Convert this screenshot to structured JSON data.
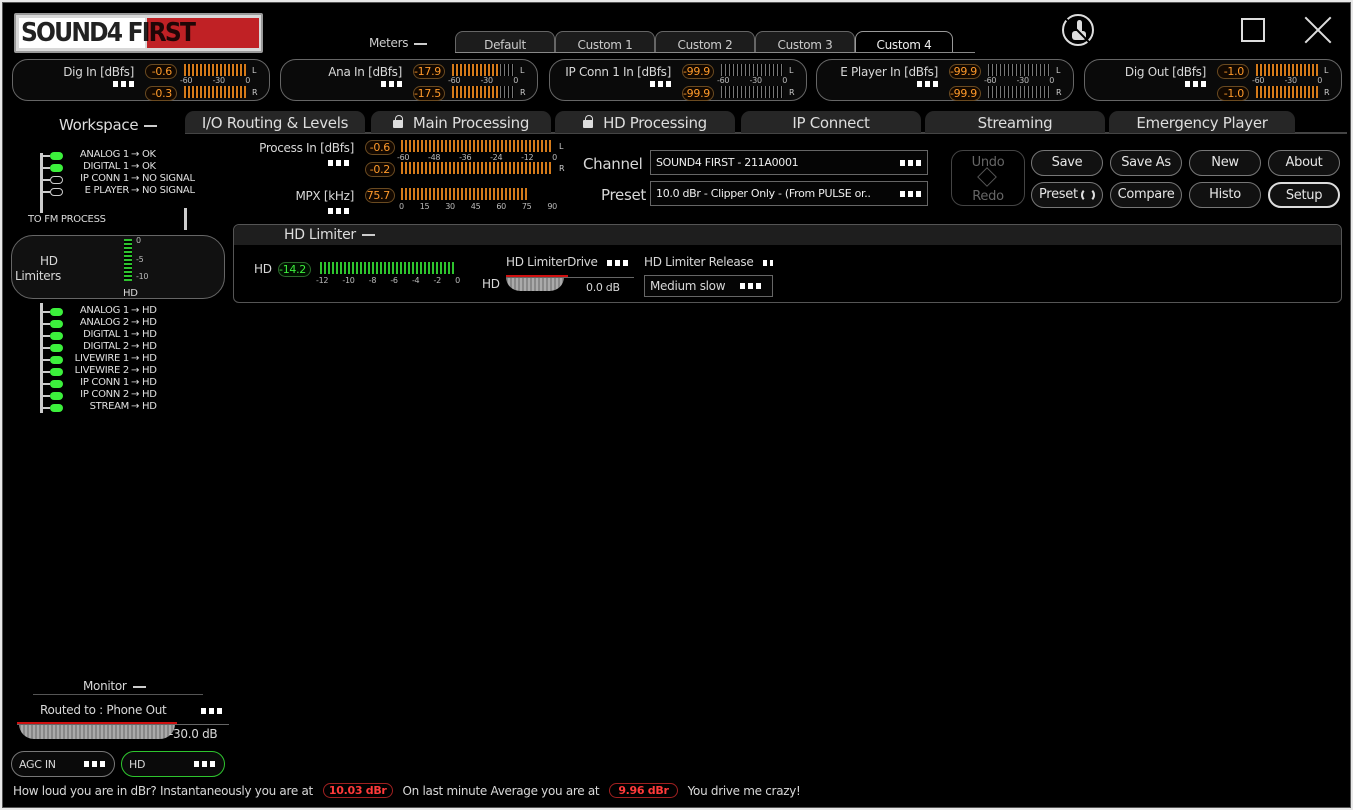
{
  "logo": {
    "text": "SOUND4 FIRST"
  },
  "window_controls": {
    "touch_icon": "touch-disabled-icon",
    "maximize_icon": "maximize-icon",
    "close_icon": "close-icon"
  },
  "meters_label": "Meters",
  "meter_tabs": [
    {
      "label": "Default",
      "active": false
    },
    {
      "label": "Custom 1",
      "active": false
    },
    {
      "label": "Custom 2",
      "active": false
    },
    {
      "label": "Custom 3",
      "active": false
    },
    {
      "label": "Custom 4",
      "active": true
    }
  ],
  "top_meters": [
    {
      "label": "Dig In [dBfs]",
      "L": "-0.6",
      "R": "-0.3",
      "scale": [
        "-60",
        "-30",
        "0"
      ]
    },
    {
      "label": "Ana In [dBfs]",
      "L": "-17.9",
      "R": "-17.5",
      "scale": [
        "-60",
        "-30",
        "0"
      ]
    },
    {
      "label": "IP Conn 1 In [dBfs]",
      "L": "-99.9",
      "R": "-99.9",
      "scale": [
        "-60",
        "-30",
        "0"
      ]
    },
    {
      "label": "E Player In [dBfs]",
      "L": "-99.9",
      "R": "-99.9",
      "scale": [
        "-60",
        "-30",
        "0"
      ]
    },
    {
      "label": "Dig Out [dBfs]",
      "L": "-1.0",
      "R": "-1.0",
      "scale": [
        "-60",
        "-30",
        "0"
      ]
    }
  ],
  "channel_letters": {
    "L": "L",
    "R": "R"
  },
  "workspace_label": "Workspace",
  "main_tabs": [
    {
      "label": "I/O Routing & Levels",
      "locked": false
    },
    {
      "label": "Main Processing",
      "locked": true
    },
    {
      "label": "HD Processing",
      "locked": true
    },
    {
      "label": "IP Connect",
      "locked": false
    },
    {
      "label": "Streaming",
      "locked": false
    },
    {
      "label": "Emergency Player",
      "locked": false
    }
  ],
  "inputs": [
    {
      "name": "ANALOG 1",
      "status": "OK",
      "on": true
    },
    {
      "name": "DIGITAL 1",
      "status": "OK",
      "on": true
    },
    {
      "name": "IP CONN 1",
      "status": "NO SIGNAL",
      "on": false
    },
    {
      "name": "E PLAYER",
      "status": "NO SIGNAL",
      "on": false
    }
  ],
  "to_fm_process": "TO FM PROCESS",
  "hd_limiters": {
    "label1": "HD",
    "label2": "Limiters",
    "meter_label": "HD",
    "scale": [
      "0",
      "-5",
      "-10"
    ]
  },
  "hd_routes": [
    {
      "name": "ANALOG 1",
      "dest": "HD"
    },
    {
      "name": "ANALOG 2",
      "dest": "HD"
    },
    {
      "name": "DIGITAL 1",
      "dest": "HD"
    },
    {
      "name": "DIGITAL 2",
      "dest": "HD"
    },
    {
      "name": "LIVEWIRE 1",
      "dest": "HD"
    },
    {
      "name": "LIVEWIRE 2",
      "dest": "HD"
    },
    {
      "name": "IP CONN 1",
      "dest": "HD"
    },
    {
      "name": "IP CONN 2",
      "dest": "HD"
    },
    {
      "name": "STREAM",
      "dest": "HD"
    }
  ],
  "process_in": {
    "label": "Process In [dBfs]",
    "L": "-0.6",
    "R": "-0.2",
    "scale": [
      "-60",
      "-48",
      "-36",
      "-24",
      "-12",
      "0"
    ]
  },
  "mpx": {
    "label": "MPX [kHz]",
    "value": "75.7",
    "scale": [
      "0",
      "15",
      "30",
      "45",
      "60",
      "75",
      "90"
    ],
    "level": 0.84
  },
  "channel": {
    "label": "Channel",
    "value": "SOUND4 FIRST - 211A0001"
  },
  "preset": {
    "label": "Preset",
    "value": "10.0 dBr -  Clipper Only - (From PULSE or.."
  },
  "buttons": {
    "undo": "Undo",
    "redo": "Redo",
    "save": "Save",
    "save_as": "Save As",
    "new": "New",
    "about": "About",
    "preset": "Preset",
    "compare": "Compare",
    "histo": "Histo",
    "setup": "Setup"
  },
  "hd_limiter_panel": {
    "title": "HD Limiter",
    "meter_label": "HD",
    "meter_value": "-14.2",
    "meter_scale": [
      "-12",
      "-10",
      "-8",
      "-6",
      "-4",
      "-2",
      "0"
    ],
    "drive_label": "HD LimiterDrive",
    "drive_knob_label": "HD",
    "drive_value": "0.0 dB",
    "release_label": "HD Limiter Release",
    "release_value": "Medium slow"
  },
  "monitor": {
    "label": "Monitor",
    "routed": "Routed to : Phone Out",
    "level": "-30.0 dB"
  },
  "agc_in": "AGC IN",
  "hd_button": "HD",
  "footer": {
    "q": "How loud you are in dBr? Instantaneously you are at",
    "inst": "10.03 dBr",
    "mid": "On last minute Average you are at",
    "avg": "9.96 dBr",
    "end": "You drive me crazy!"
  }
}
